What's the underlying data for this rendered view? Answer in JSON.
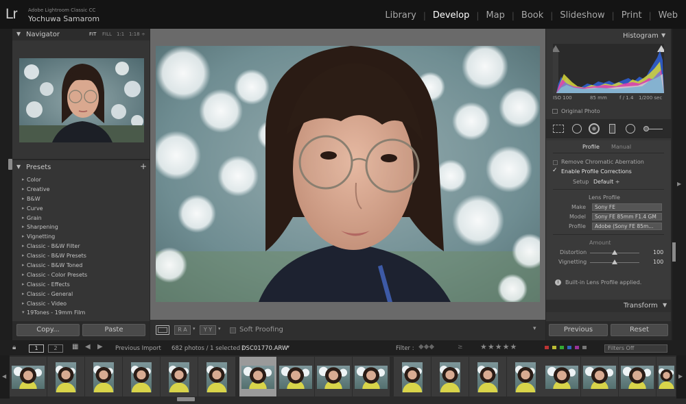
{
  "app": {
    "logo": "Lr",
    "title": "Adobe Lightroom Classic CC",
    "user": "Yochuwa Samarom"
  },
  "modules": [
    "Library",
    "Develop",
    "Map",
    "Book",
    "Slideshow",
    "Print",
    "Web"
  ],
  "active_module": "Develop",
  "navigator": {
    "title": "Navigator",
    "zoom": [
      "FIT",
      "FILL",
      "1:1",
      "1:18 ÷"
    ]
  },
  "presets": {
    "title": "Presets",
    "add": "+",
    "items": [
      "Color",
      "Creative",
      "B&W",
      "Curve",
      "Grain",
      "Sharpening",
      "Vignetting",
      "Classic - B&W Filter",
      "Classic - B&W Presets",
      "Classic - B&W Toned",
      "Classic - Color Presets",
      "Classic - Effects",
      "Classic - General",
      "Classic - Video",
      "19Tones - 19mm Film"
    ]
  },
  "left_buttons": {
    "copy": "Copy...",
    "paste": "Paste"
  },
  "toolbar": {
    "soft_proofing": "Soft Proofing",
    "compare1": "R A",
    "compare2": "Y Y"
  },
  "histogram": {
    "title": "Histogram",
    "iso": "ISO 100",
    "focal": "85 mm",
    "aperture": "f / 1.4",
    "shutter": "1/200 sec",
    "original_photo": "Original Photo"
  },
  "lens": {
    "tab_profile": "Profile",
    "tab_manual": "Manual",
    "remove_ca": "Remove Chromatic Aberration",
    "enable_profile": "Enable Profile Corrections",
    "setup_label": "Setup",
    "setup_value": "Default ÷",
    "lens_profile_title": "Lens Profile",
    "make_label": "Make",
    "make_value": "Sony FE",
    "model_label": "Model",
    "model_value": "Sony FE 85mm F1.4 GM",
    "profile_label": "Profile",
    "profile_value": "Adobe (Sony FE 85m...",
    "amount_title": "Amount",
    "distortion_label": "Distortion",
    "distortion_value": "100",
    "vignetting_label": "Vignetting",
    "vignetting_value": "100",
    "info": "Built-in Lens Profile applied.",
    "transform_title": "Transform"
  },
  "right_buttons": {
    "previous": "Previous",
    "reset": "Reset"
  },
  "filmbar": {
    "page1": "1",
    "page2": "2",
    "source": "Previous Import",
    "count": "682 photos / 1 selected /",
    "filename": "DSC01770.ARW",
    "filter_label": "Filter :",
    "filters_off": "Filters Off"
  },
  "colors": {
    "accent": "#ffffff",
    "panel": "#353535",
    "background": "#262626"
  }
}
